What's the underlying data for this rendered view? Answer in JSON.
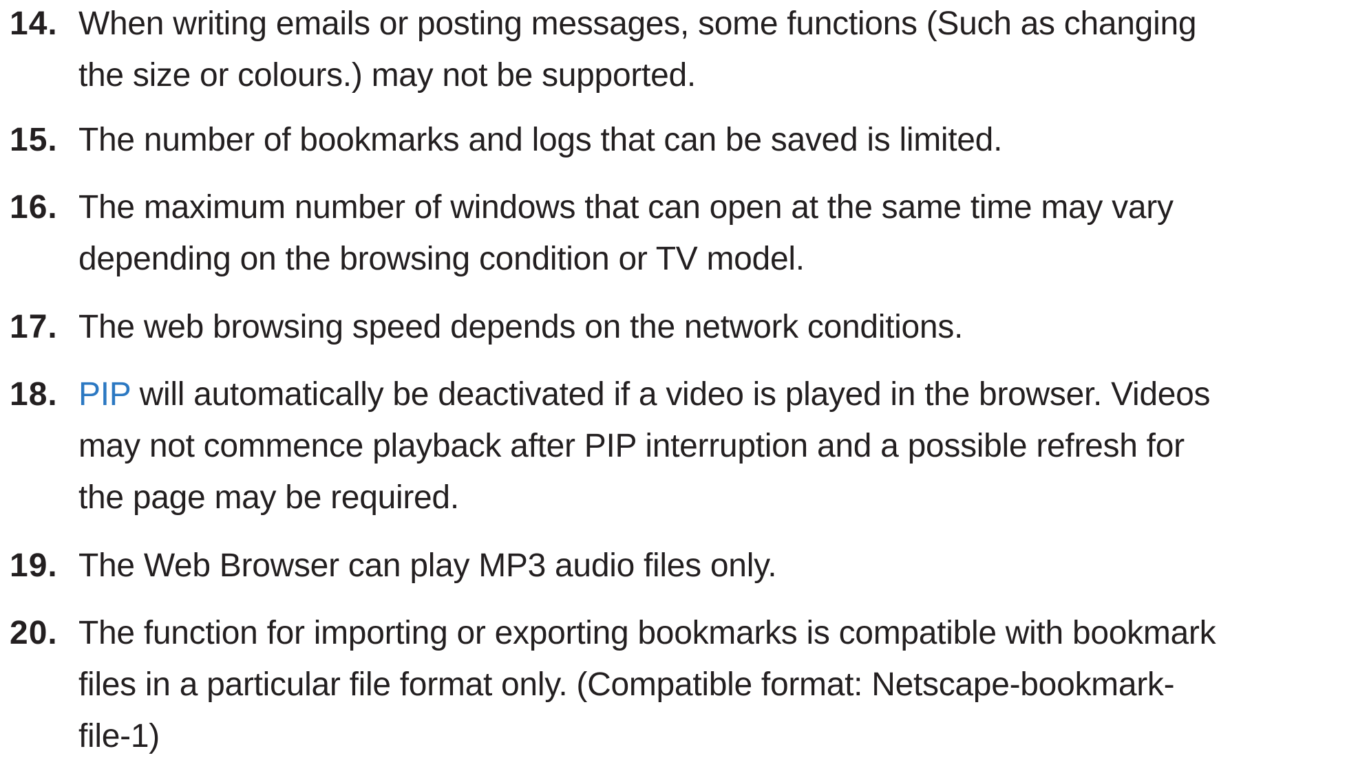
{
  "items": [
    {
      "number": "14.",
      "lines": [
        "When writing emails or posting messages, some functions (Such as changing",
        "the size or colours.) may not be supported."
      ]
    },
    {
      "number": "15.",
      "lines": [
        "The number of bookmarks and logs that can be saved is limited."
      ]
    },
    {
      "number": "16.",
      "lines": [
        "The maximum number of windows that can open at the same time may vary",
        "depending on the browsing condition or TV model."
      ]
    },
    {
      "number": "17.",
      "lines": [
        "The web browsing speed depends on the network conditions."
      ]
    },
    {
      "number": "18.",
      "link": "PIP",
      "line1_rest": " will automatically be deactivated if a video is played in the browser. Videos",
      "lines": [
        "may not commence playback after PIP interruption and a possible refresh for",
        "the page may be required."
      ]
    },
    {
      "number": "19.",
      "lines": [
        "The Web Browser can play MP3 audio files only."
      ]
    },
    {
      "number": "20.",
      "lines": [
        "The function for importing or exporting bookmarks is compatible with bookmark",
        "files in a particular file format only. (Compatible format: Netscape-bookmark-",
        "file-1)"
      ]
    }
  ],
  "colors": {
    "text": "#231f20",
    "link": "#2b78c2",
    "background": "#ffffff"
  }
}
